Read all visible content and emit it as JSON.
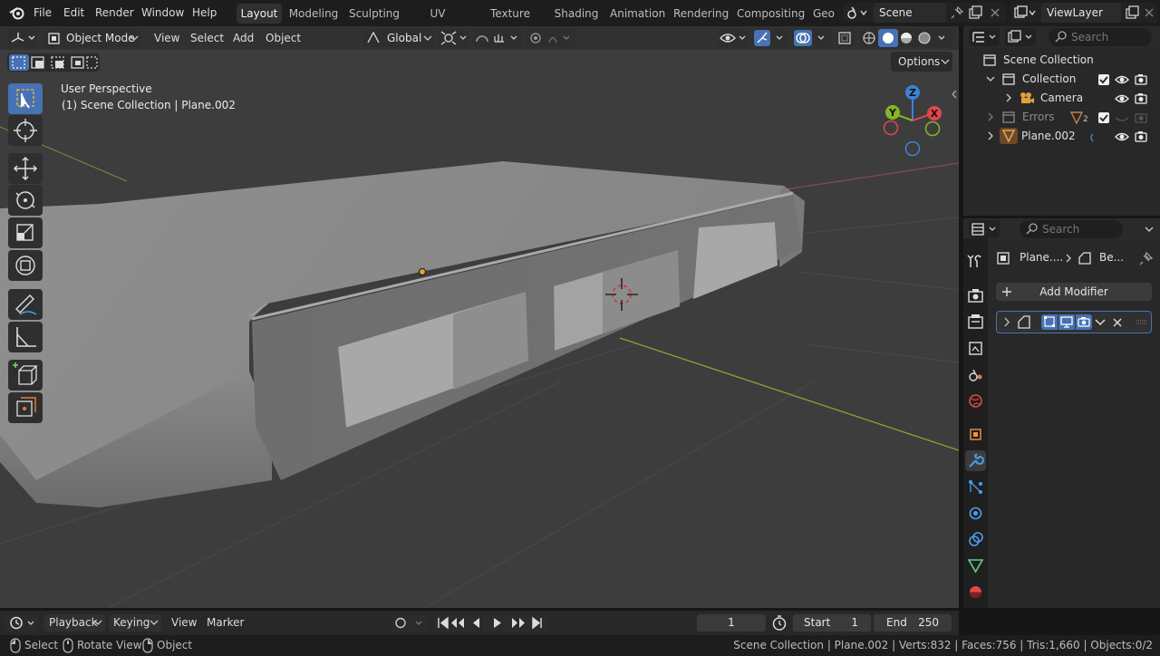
{
  "menubar": {
    "items": [
      "File",
      "Edit",
      "Render",
      "Window",
      "Help"
    ],
    "workspaces": [
      "Layout",
      "Modeling",
      "Sculpting",
      "UV Editing",
      "Texture Paint",
      "Shading",
      "Animation",
      "Rendering",
      "Compositing",
      "Geo"
    ],
    "active_workspace": "Layout",
    "scene": "Scene",
    "view_layer": "ViewLayer"
  },
  "viewport_header": {
    "mode": "Object Mode",
    "menus": [
      "View",
      "Select",
      "Add",
      "Object"
    ],
    "transform_orientation": "Global",
    "options_label": "Options"
  },
  "viewport_overlay": {
    "perspective": "User Perspective",
    "context": "(1) Scene Collection | Plane.002"
  },
  "gizmo": {
    "x": "X",
    "y": "Y",
    "z": "Z"
  },
  "outliner": {
    "search_placeholder": "Search",
    "rows": [
      {
        "label": "Scene Collection",
        "type": "scene-collection"
      },
      {
        "label": "Collection",
        "type": "collection"
      },
      {
        "label": "Camera",
        "type": "camera"
      },
      {
        "label": "Errors",
        "type": "collection-disabled",
        "badge": "2"
      },
      {
        "label": "Plane.002",
        "type": "mesh"
      }
    ]
  },
  "properties": {
    "search_placeholder": "Search",
    "breadcrumb_object": "Plane....",
    "breadcrumb_modifier": "Be...",
    "add_modifier_label": "Add Modifier"
  },
  "timeline": {
    "menus": [
      "Playback",
      "Keying",
      "View",
      "Marker"
    ],
    "current_frame": "1",
    "start_label": "Start",
    "start_value": "1",
    "end_label": "End",
    "end_value": "250"
  },
  "statusbar": {
    "select": "Select",
    "rotate_view": "Rotate View",
    "object": "Object",
    "info": "Scene Collection | Plane.002 | Verts:832 | Faces:756 | Tris:1,660 | Objects:0/2"
  },
  "colors": {
    "accent": "#4772b3",
    "x_axis": "#e4454e",
    "y_axis": "#87b528",
    "z_axis": "#3d82d8",
    "object_origin": "#f0a030"
  }
}
